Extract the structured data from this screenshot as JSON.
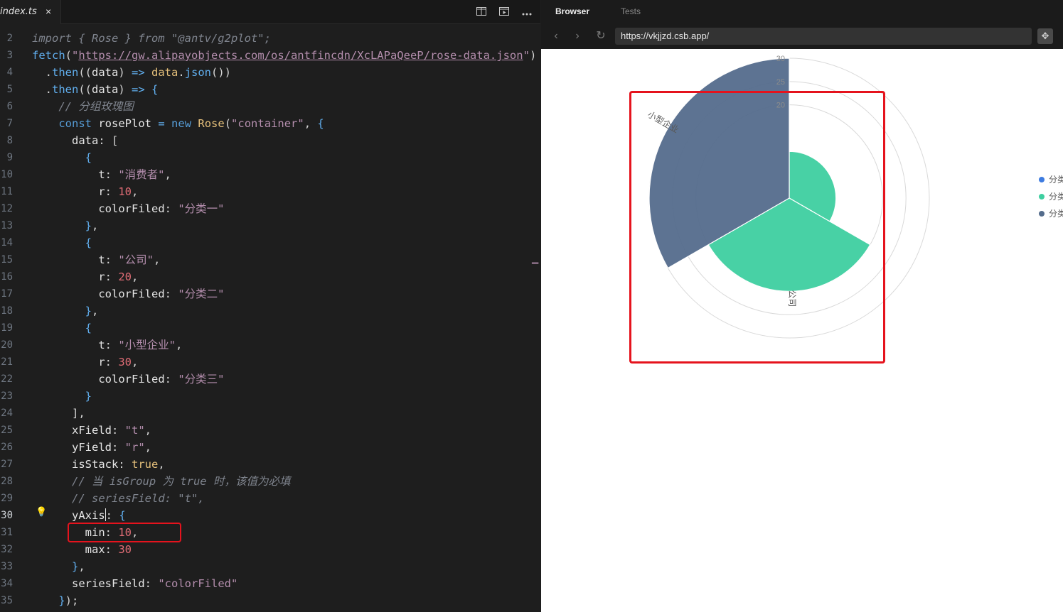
{
  "editor": {
    "tab": {
      "filename": "index.ts",
      "close": "×"
    },
    "toolbar": {
      "split_icon": "split-editor-icon",
      "preview_icon": "preview-icon",
      "more_icon": "more-icon"
    },
    "active_line": "30",
    "lines": [
      {
        "n": "2",
        "html": "<span class=\"c-cmt\">import { Rose } from \"@antv/g2plot\";</span>"
      },
      {
        "n": "3",
        "html": "<span class=\"c-fn\">fetch</span>(<span class=\"c-str\">\"</span><span class=\"c-url\">https://gw.alipayobjects.com/os/antfincdn/XcLAPaQeeP/rose-data.json</span><span class=\"c-str\">\"</span>)"
      },
      {
        "n": "4",
        "html": "  .<span class=\"c-fn\">then</span>((<span class=\"c-var\">data</span>) <span class=\"c-op\">=></span> <span class=\"c-obj\">data</span>.<span class=\"c-fn\">json</span>())"
      },
      {
        "n": "5",
        "html": "  .<span class=\"c-fn\">then</span>((<span class=\"c-var\">data</span>) <span class=\"c-op\">=></span> <span class=\"c-p\">{</span>"
      },
      {
        "n": "6",
        "html": "    <span class=\"c-cmt\">// 分组玫瑰图</span>"
      },
      {
        "n": "7",
        "html": "    <span class=\"c-kw\">const</span> <span class=\"c-var\">rosePlot</span> <span class=\"c-op\">=</span> <span class=\"c-kw\">new</span> <span class=\"c-cls\">Rose</span>(<span class=\"c-str\">\"container\"</span>, <span class=\"c-p\">{</span>"
      },
      {
        "n": "8",
        "html": "      <span class=\"c-prop\">data</span>: ["
      },
      {
        "n": "9",
        "html": "        <span class=\"c-p\">{</span>"
      },
      {
        "n": "10",
        "html": "          <span class=\"c-prop\">t</span>: <span class=\"c-str\">\"消费者\"</span>,"
      },
      {
        "n": "11",
        "html": "          <span class=\"c-prop\">r</span>: <span class=\"c-num\">10</span>,"
      },
      {
        "n": "12",
        "html": "          <span class=\"c-prop\">colorFiled</span>: <span class=\"c-str\">\"分类一\"</span>"
      },
      {
        "n": "13",
        "html": "        <span class=\"c-p\">}</span>,"
      },
      {
        "n": "14",
        "html": "        <span class=\"c-p\">{</span>"
      },
      {
        "n": "15",
        "html": "          <span class=\"c-prop\">t</span>: <span class=\"c-str\">\"公司\"</span>,"
      },
      {
        "n": "16",
        "html": "          <span class=\"c-prop\">r</span>: <span class=\"c-num\">20</span>,"
      },
      {
        "n": "17",
        "html": "          <span class=\"c-prop\">colorFiled</span>: <span class=\"c-str\">\"分类二\"</span>"
      },
      {
        "n": "18",
        "html": "        <span class=\"c-p\">}</span>,"
      },
      {
        "n": "19",
        "html": "        <span class=\"c-p\">{</span>"
      },
      {
        "n": "20",
        "html": "          <span class=\"c-prop\">t</span>: <span class=\"c-str\">\"小型企业\"</span>,"
      },
      {
        "n": "21",
        "html": "          <span class=\"c-prop\">r</span>: <span class=\"c-num\">30</span>,"
      },
      {
        "n": "22",
        "html": "          <span class=\"c-prop\">colorFiled</span>: <span class=\"c-str\">\"分类三\"</span>"
      },
      {
        "n": "23",
        "html": "        <span class=\"c-p\">}</span>"
      },
      {
        "n": "24",
        "html": "      ],"
      },
      {
        "n": "25",
        "html": "      <span class=\"c-prop\">xField</span>: <span class=\"c-str\">\"t\"</span>,"
      },
      {
        "n": "26",
        "html": "      <span class=\"c-prop\">yField</span>: <span class=\"c-str\">\"r\"</span>,"
      },
      {
        "n": "27",
        "html": "      <span class=\"c-prop\">isStack</span>: <span class=\"c-bool\">true</span>,"
      },
      {
        "n": "28",
        "html": "      <span class=\"c-cmt\">// 当 isGroup 为 true 时，该值为必填</span>"
      },
      {
        "n": "29",
        "html": "      <span class=\"c-cmt\">// seriesField: \"t\",</span>"
      },
      {
        "n": "30",
        "html": "      <span class=\"c-prop\">yAxis</span><span class=\"cursor\"></span>: <span class=\"c-p\">{</span>"
      },
      {
        "n": "31",
        "html": "        <span class=\"c-prop\">min</span>: <span class=\"c-num\">10</span>,"
      },
      {
        "n": "32",
        "html": "        <span class=\"c-prop\">max</span>: <span class=\"c-num\">30</span>"
      },
      {
        "n": "33",
        "html": "      <span class=\"c-p\">}</span>,"
      },
      {
        "n": "34",
        "html": "      <span class=\"c-prop\">seriesField</span>: <span class=\"c-str\">\"colorFiled\"</span>"
      },
      {
        "n": "35",
        "html": "    <span class=\"c-p\">}</span>);"
      }
    ]
  },
  "browser": {
    "tabs": {
      "active": "Browser",
      "inactive": "Tests"
    },
    "url": "https://vkjjzd.csb.app/",
    "nav": {
      "back": "‹",
      "forward": "›",
      "reload": "↻",
      "action": "✥"
    }
  },
  "colors": {
    "series1": "#3ecfa0",
    "series2": "#3ecfa0",
    "series3": "#546c8c",
    "highlight": "#e5131d"
  },
  "chart_data": {
    "type": "rose",
    "categories": [
      "消费者",
      "公司",
      "小型企业"
    ],
    "values": [
      10,
      20,
      30
    ],
    "series_field": "colorFiled",
    "series": [
      {
        "name": "分类一",
        "category": "消费者",
        "value": 10,
        "color": "#3ecfa0"
      },
      {
        "name": "分类二",
        "category": "公司",
        "value": 20,
        "color": "#3ecfa0"
      },
      {
        "name": "分类三",
        "category": "小型企业",
        "value": 30,
        "color": "#546c8c"
      }
    ],
    "ylim": [
      10,
      30
    ],
    "tick_labels": [
      "20",
      "25",
      "30"
    ],
    "category_labels_shown": [
      "公司",
      "小型企业"
    ],
    "legend": {
      "placement": "right",
      "labels": [
        "分类",
        "分类",
        "分类"
      ],
      "colors": [
        "#3d7be0",
        "#3ecfa0",
        "#546c8c"
      ]
    }
  }
}
